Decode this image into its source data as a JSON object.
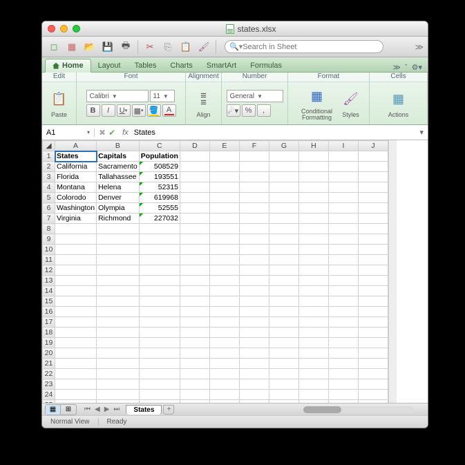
{
  "title": "states.xlsx",
  "search_placeholder": "Search in Sheet",
  "tabs": [
    "Home",
    "Layout",
    "Tables",
    "Charts",
    "SmartArt",
    "Formulas"
  ],
  "tabs_more": "≫",
  "ribbon": {
    "edit": "Edit",
    "font": "Font",
    "alignment": "Alignment",
    "number": "Number",
    "format": "Format",
    "cells": "Cells",
    "paste": "Paste",
    "font_name": "Calibri",
    "font_size": "11",
    "align": "Align",
    "number_format": "General",
    "percent": "%",
    "comma": ",",
    "cond_fmt": "Conditional Formatting",
    "styles": "Styles",
    "actions": "Actions"
  },
  "namebox": "A1",
  "fx": "fx",
  "cellvalue": "States",
  "columns": [
    "A",
    "B",
    "C",
    "D",
    "E",
    "F",
    "G",
    "H",
    "I",
    "J"
  ],
  "rows": 25,
  "data": {
    "headers": [
      "States",
      "Capitals",
      "Population"
    ],
    "rows": [
      [
        "California",
        "Sacramento",
        "508529"
      ],
      [
        "Florida",
        "Tallahassee",
        "193551"
      ],
      [
        "Montana",
        "Helena",
        "52315"
      ],
      [
        "Colorodo",
        "Denver",
        "619968"
      ],
      [
        "Washington",
        "Olympia",
        "52555"
      ],
      [
        "Virginia",
        "Richmond",
        "227032"
      ]
    ]
  },
  "sheet_name": "States",
  "view_label": "Normal View",
  "status": "Ready"
}
